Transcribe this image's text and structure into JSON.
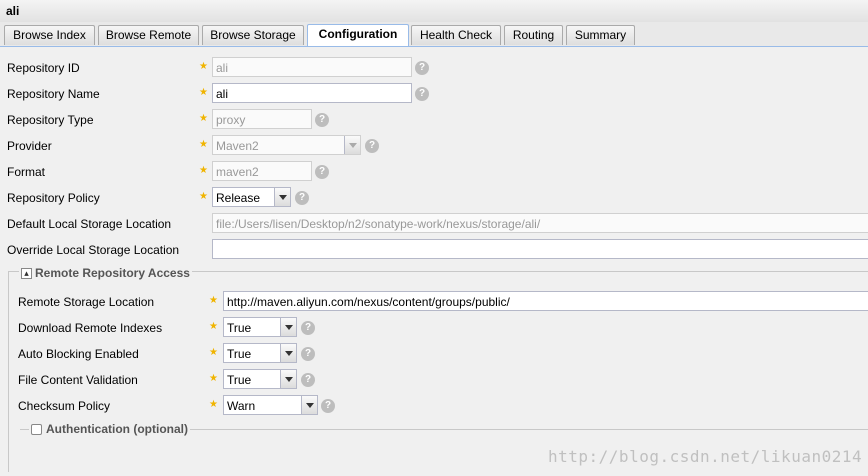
{
  "window": {
    "title": "ali"
  },
  "tabs": [
    {
      "label": "Browse Index"
    },
    {
      "label": "Browse Remote"
    },
    {
      "label": "Browse Storage"
    },
    {
      "label": "Configuration",
      "active": true
    },
    {
      "label": "Health Check"
    },
    {
      "label": "Routing"
    },
    {
      "label": "Summary"
    }
  ],
  "form": {
    "repository_id": {
      "label": "Repository ID",
      "value": "ali"
    },
    "repository_name": {
      "label": "Repository Name",
      "value": "ali"
    },
    "repository_type": {
      "label": "Repository Type",
      "value": "proxy"
    },
    "provider": {
      "label": "Provider",
      "value": "Maven2"
    },
    "format": {
      "label": "Format",
      "value": "maven2"
    },
    "repository_policy": {
      "label": "Repository Policy",
      "value": "Release"
    },
    "default_local_storage": {
      "label": "Default Local Storage Location",
      "value": "file:/Users/lisen/Desktop/n2/sonatype-work/nexus/storage/ali/"
    },
    "override_local_storage": {
      "label": "Override Local Storage Location",
      "value": ""
    }
  },
  "remote_access": {
    "legend": "Remote Repository Access",
    "remote_storage_location": {
      "label": "Remote Storage Location",
      "value": "http://maven.aliyun.com/nexus/content/groups/public/"
    },
    "download_remote_indexes": {
      "label": "Download Remote Indexes",
      "value": "True"
    },
    "auto_blocking_enabled": {
      "label": "Auto Blocking Enabled",
      "value": "True"
    },
    "file_content_validation": {
      "label": "File Content Validation",
      "value": "True"
    },
    "checksum_policy": {
      "label": "Checksum Policy",
      "value": "Warn"
    }
  },
  "authentication": {
    "legend": "Authentication (optional)"
  },
  "watermark": "http://blog.csdn.net/likuan0214",
  "colors": {
    "required_star": "#f0b400",
    "tab_border_active": "#99bbe8"
  }
}
